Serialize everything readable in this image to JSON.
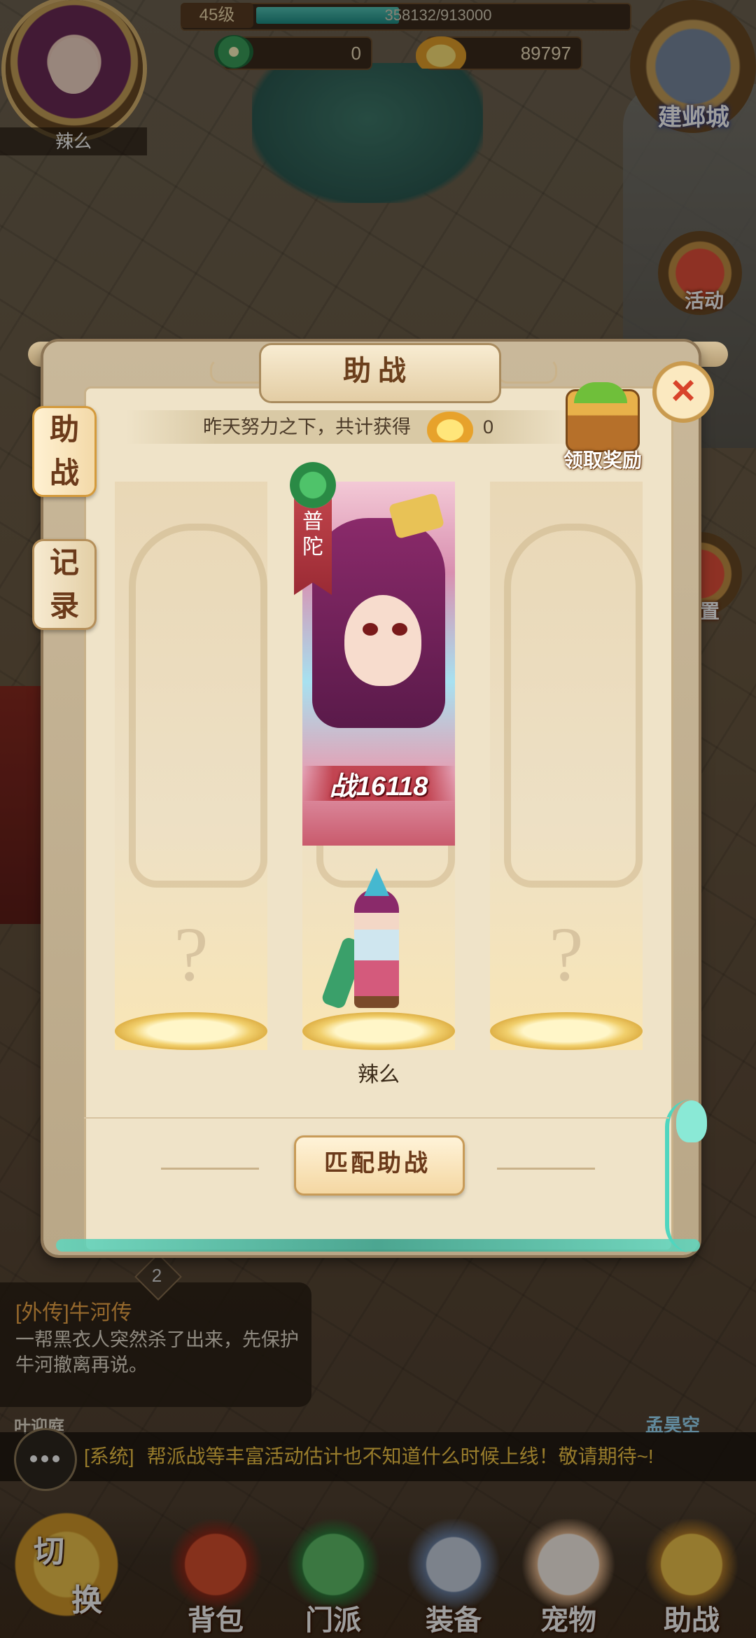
{
  "hud": {
    "player_name": "辣么",
    "level": "45级",
    "exp_text": "358132/913000",
    "exp_progress": 0.392,
    "jade_count": "0",
    "gold_count": "89797",
    "city_label": "建邺城"
  },
  "side_buttons": {
    "activity": "活动",
    "settings": "设置"
  },
  "dialog": {
    "title": "助战",
    "tabs": [
      {
        "line1": "助",
        "line2": "战",
        "active": true
      },
      {
        "line1": "记",
        "line2": "录",
        "active": false
      }
    ],
    "info_text": "昨天努力之下，共计获得",
    "info_count": "0",
    "reward_label": "领取奖励",
    "left_slot_mark": "?",
    "right_slot_mark": "?",
    "hero": {
      "school": "普陀",
      "power_text": "战16118",
      "name": "辣么"
    },
    "match_button": "匹配助战"
  },
  "quest": {
    "badge": "2",
    "title": "[外传]牛河传",
    "description": "一帮黑衣人突然杀了出来，先保护牛河撤离再说。"
  },
  "npc_names": {
    "left": "叶迎庭",
    "right": "孟昊空"
  },
  "chat": {
    "tag": "[系统]",
    "message": "帮派战等丰富活动估计也不知道什么时候上线！敬请期待~!"
  },
  "bottom_nav": {
    "switch_top": "切",
    "switch_bottom": "换",
    "items": [
      "背包",
      "门派",
      "装备",
      "宠物",
      "助战"
    ]
  },
  "colors": {
    "title_brown": "#6b3f1c",
    "close_red": "#d8432a",
    "chat_yellow": "#f5c846",
    "quest_orange": "#f0a848",
    "exp_teal": "#1f8f86",
    "jade_green": "#4fd6bf"
  },
  "icons": [
    "avatar-portrait",
    "jade-coin-icon",
    "gold-ingot-icon",
    "city-icon",
    "activity-icon",
    "settings-icon",
    "close-icon",
    "treasure-chest-icon",
    "school-emblem-icon",
    "chat-bubble-icon",
    "backpack-icon",
    "sect-icon",
    "equipment-icon",
    "pet-icon",
    "assist-icon"
  ]
}
